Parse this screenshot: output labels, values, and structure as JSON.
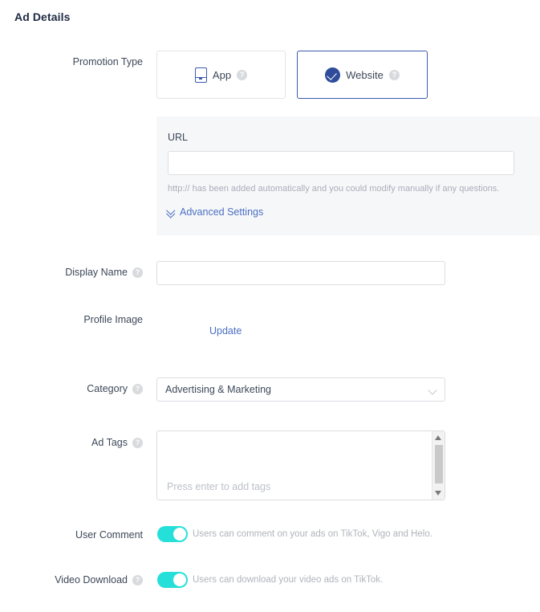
{
  "section": {
    "title": "Ad Details"
  },
  "promotion_type": {
    "label": "Promotion Type",
    "options": [
      {
        "label": "App",
        "icon": "phone-icon",
        "selected": false
      },
      {
        "label": "Website",
        "icon": "check-circle-icon",
        "selected": true
      }
    ]
  },
  "url": {
    "label": "URL",
    "value": "",
    "placeholder": "",
    "hint": "http:// has been added automatically and you could modify manually if any questions.",
    "advanced_settings_label": "Advanced Settings"
  },
  "display_name": {
    "label": "Display Name",
    "value": "",
    "placeholder": ""
  },
  "profile_image": {
    "label": "Profile Image",
    "update_label": "Update"
  },
  "category": {
    "label": "Category",
    "selected": "Advertising & Marketing"
  },
  "ad_tags": {
    "label": "Ad Tags",
    "placeholder": "Press enter to add tags",
    "value": ""
  },
  "user_comment": {
    "label": "User Comment",
    "enabled": true,
    "description": "Users can comment on your ads on TikTok, Vigo and Helo."
  },
  "video_download": {
    "label": "Video Download",
    "enabled": true,
    "description": "Users can download your video ads on TikTok."
  },
  "colors": {
    "accent_blue": "#3b5bab",
    "link_blue": "#4a6fc3",
    "toggle_on": "#25e0d9",
    "panel_bg": "#f6f7f9",
    "border": "#dcdee2",
    "text": "#3c4858",
    "muted": "#a9aeb8"
  }
}
